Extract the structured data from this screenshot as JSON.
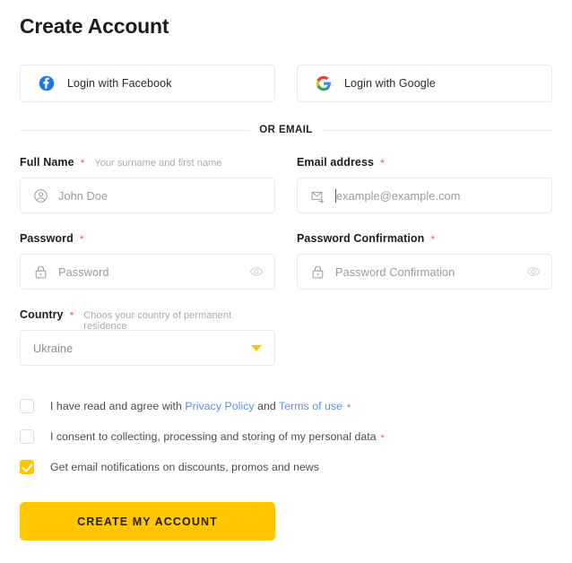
{
  "page": {
    "title": "Create Account"
  },
  "social": {
    "facebook": {
      "label": "Login with Facebook",
      "icon": "facebook-icon",
      "color": "#1877F2"
    },
    "google": {
      "label": "Login with Google",
      "icon": "google-icon",
      "colors": [
        "#EA4335",
        "#FBBC05",
        "#34A853",
        "#4285F4"
      ]
    }
  },
  "divider": {
    "label": "OR EMAIL"
  },
  "fields": {
    "full_name": {
      "label": "Full Name",
      "required_mark": "*",
      "hint": "Your surname and first name",
      "placeholder": "John Doe",
      "value": "",
      "lead_icon": "user-circle-icon"
    },
    "email": {
      "label": "Email address",
      "required_mark": "*",
      "hint": "",
      "placeholder": "example@example.com",
      "value": "",
      "lead_icon": "envelope-icon",
      "focused": true
    },
    "password": {
      "label": "Password",
      "required_mark": "*",
      "hint": "",
      "placeholder": "Password",
      "value": "",
      "lead_icon": "lock-icon",
      "trail_icon": "eye-icon"
    },
    "password_confirmation": {
      "label": "Password Confirmation",
      "required_mark": "*",
      "hint": "",
      "placeholder": "Password Confirmation",
      "value": "",
      "lead_icon": "lock-icon",
      "trail_icon": "eye-icon"
    },
    "country": {
      "label": "Country",
      "required_mark": "*",
      "hint": "Choos your country of permanent residence",
      "selected": "Ukraine",
      "caret_color": "#ffc700"
    }
  },
  "checkboxes": [
    {
      "checked": false,
      "text_before": "I have read and agree with ",
      "link1": "Privacy Policy",
      "text_middle": " and ",
      "link2": "Terms of use",
      "required_mark": "*"
    },
    {
      "checked": false,
      "text_before": "I consent to collecting, processing and storing of my personal data",
      "required_mark": "*"
    },
    {
      "checked": true,
      "text_before": "Get email notifications on discounts, promos and news",
      "required_mark": ""
    }
  ],
  "submit": {
    "label": "CREATE MY ACCOUNT",
    "color": "#ffc700"
  }
}
